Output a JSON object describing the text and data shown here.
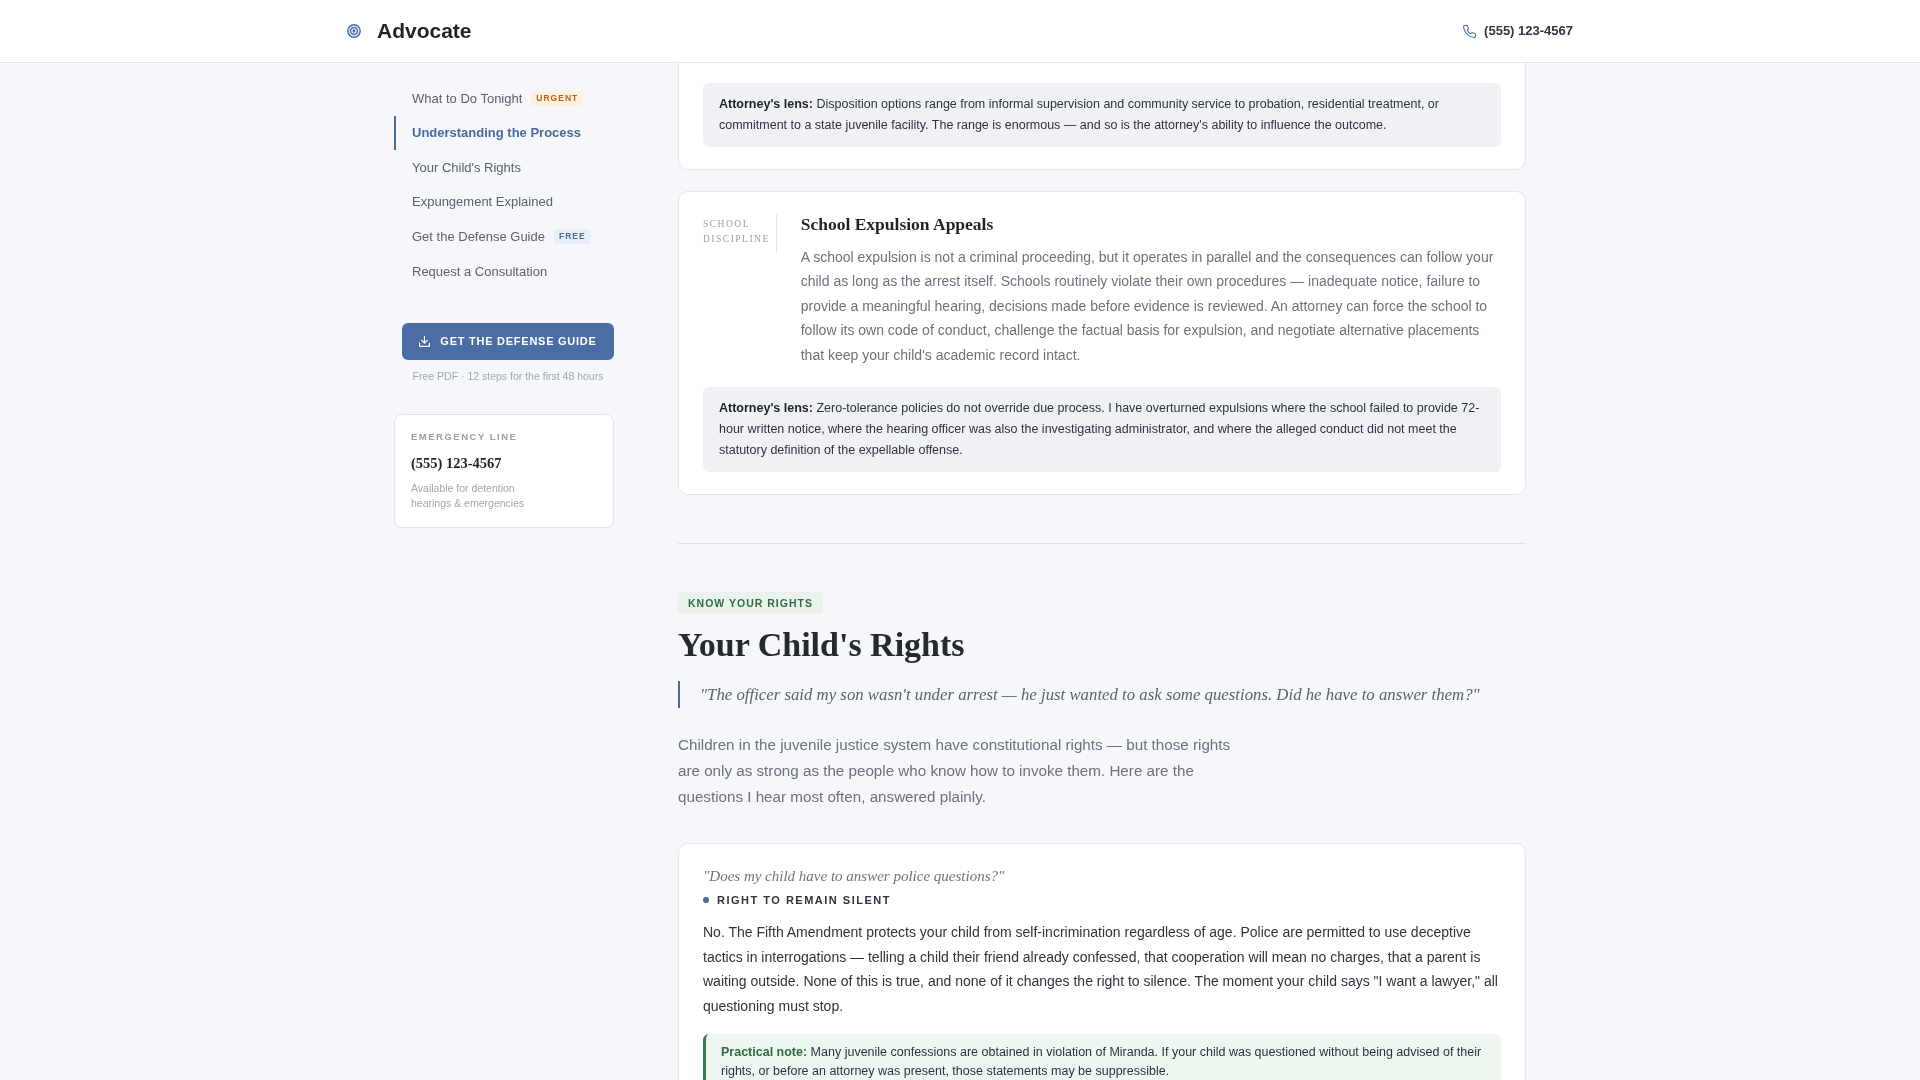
{
  "header": {
    "brand": "Advocate",
    "phone": "(555) 123-4567"
  },
  "sidebar": {
    "nav": [
      {
        "label": "What to Do Tonight",
        "selected": false,
        "badge": {
          "text": "URGENT",
          "kind": "urgent"
        }
      },
      {
        "label": "Understanding the Process",
        "selected": true
      },
      {
        "label": "Your Child's Rights",
        "selected": false
      },
      {
        "label": "Expungement Explained",
        "selected": false
      },
      {
        "label": "Get the Defense Guide",
        "selected": false,
        "badge": {
          "text": "FREE",
          "kind": "free"
        }
      },
      {
        "label": "Request a Consultation",
        "selected": false
      }
    ],
    "cta": {
      "button": "GET THE DEFENSE GUIDE",
      "note": "Free PDF · 12 steps for the first 48 hours"
    },
    "emergency": {
      "label": "EMERGENCY LINE",
      "phone": "(555) 123-4567",
      "note": "Available for detention hearings & emergencies"
    }
  },
  "main": {
    "cards": [
      {
        "lens": "**Attorney's lens:** Disposition options range from informal supervision and community service to probation, residential treatment, or commitment to a state juvenile facility. The range is enormous — and so is the attorney's ability to influence the outcome."
      },
      {
        "category": "SCHOOL DISCIPLINE",
        "title": "School Expulsion Appeals",
        "body": "A school expulsion is not a criminal proceeding, but it operates in parallel and the consequences can follow your child as long as the arrest itself. Schools routinely violate their own procedures — inadequate notice, failure to provide a meaningful hearing, decisions made before evidence is reviewed. An attorney can force the school to follow its own code of conduct, challenge the factual basis for expulsion, and negotiate alternative placements that keep your child's academic record intact.",
        "lens": "**Attorney's lens:** Zero-tolerance policies do not override due process. I have overturned expulsions where the school failed to provide 72-hour written notice, where the hearing officer was also the investigating administrator, and where the alleged conduct did not meet the statutory definition of the expellable offense."
      }
    ],
    "section": {
      "tag": "KNOW YOUR RIGHTS",
      "title": "Your Child's Rights",
      "quote": "\"The officer said my son wasn't under arrest — he just wanted to ask some questions. Did he have to answer them?\"",
      "intro": "Children in the juvenile justice system have constitutional rights — but those rights are only as strong as the people who know how to invoke them. Here are the questions I hear most often, answered plainly.",
      "questions": [
        {
          "question": "\"Does my child have to answer police questions?\"",
          "tag": "RIGHT TO REMAIN SILENT",
          "answer": "No. The Fifth Amendment protects your child from self-incrimination regardless of age. Police are permitted to use deceptive tactics in interrogations — telling a child their friend already confessed, that cooperation will mean no charges, that a parent is waiting outside. None of this is true, and none of it changes the right to silence. The moment your child says \"I want a lawyer,\" all questioning must stop.",
          "note": "**Practical note:** Many juvenile confessions are obtained in violation of Miranda. If your child was questioned without being advised of their rights, or before an attorney was present, those statements may be suppressible."
        }
      ]
    }
  }
}
